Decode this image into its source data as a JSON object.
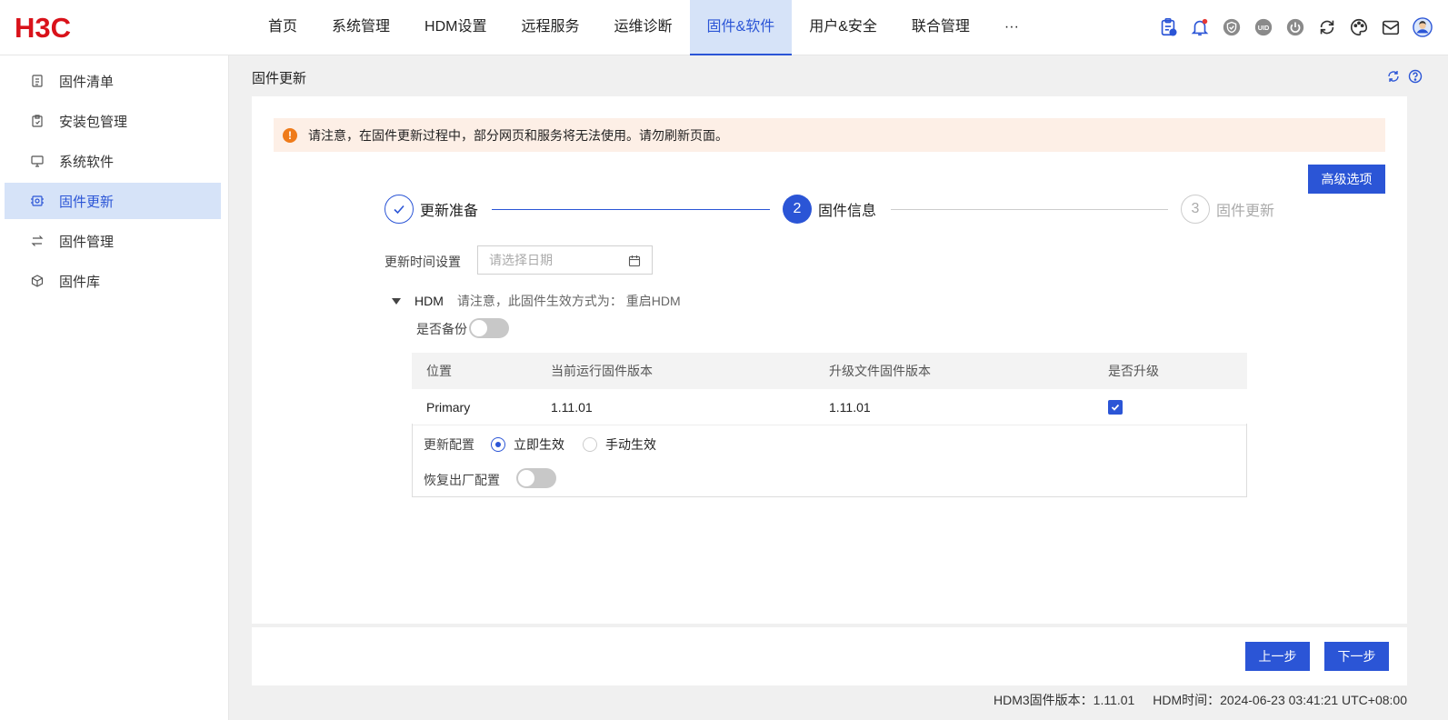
{
  "brand": {
    "logo_text": "H3C"
  },
  "nav": {
    "items": [
      "首页",
      "系统管理",
      "HDM设置",
      "远程服务",
      "运维诊断",
      "固件&软件",
      "用户&安全",
      "联合管理",
      "···"
    ],
    "active_index": 5
  },
  "tools": {
    "icons": [
      "clipboard-icon",
      "bell-icon",
      "shield-icon",
      "uid-icon",
      "power-icon",
      "sync-icon",
      "palette-icon",
      "mail-icon",
      "user-avatar-icon"
    ],
    "uid_text": "UID",
    "accent": "#2b55d6",
    "alert_dot": "#e53935"
  },
  "sidebar": {
    "items": [
      {
        "label": "固件清单",
        "icon": "list-icon"
      },
      {
        "label": "安装包管理",
        "icon": "package-icon"
      },
      {
        "label": "系统软件",
        "icon": "monitor-icon"
      },
      {
        "label": "固件更新",
        "icon": "chip-icon"
      },
      {
        "label": "固件管理",
        "icon": "swap-icon"
      },
      {
        "label": "固件库",
        "icon": "cube-icon"
      }
    ],
    "active_index": 3
  },
  "page": {
    "title": "固件更新"
  },
  "alert": {
    "icon_text": "!",
    "text": "请注意，在固件更新过程中，部分网页和服务将无法使用。请勿刷新页面。"
  },
  "advanced_button": "高级选项",
  "steps": {
    "items": [
      {
        "number": "",
        "label": "更新准备",
        "state": "done"
      },
      {
        "number": "2",
        "label": "固件信息",
        "state": "current"
      },
      {
        "number": "3",
        "label": "固件更新",
        "state": "pending"
      }
    ]
  },
  "schedule": {
    "label": "更新时间设置",
    "placeholder": "请选择日期"
  },
  "hdm": {
    "name": "HDM",
    "note": "请注意，此固件生效方式为： 重启HDM",
    "backup_label": "是否备份",
    "backup_on": false
  },
  "table": {
    "headers": [
      "位置",
      "当前运行固件版本",
      "升级文件固件版本",
      "是否升级"
    ],
    "rows": [
      {
        "location": "Primary",
        "current": "1.11.01",
        "upgrade": "1.11.01",
        "checked": true
      }
    ]
  },
  "config": {
    "label": "更新配置",
    "options": [
      "立即生效",
      "手动生效"
    ],
    "selected_index": 0,
    "factory_label": "恢复出厂配置",
    "factory_on": false
  },
  "footer": {
    "prev": "上一步",
    "next": "下一步"
  },
  "status": {
    "firmware": "HDM3固件版本：1.11.01",
    "time": "HDM时间：2024-06-23 03:41:21 UTC+08:00"
  }
}
